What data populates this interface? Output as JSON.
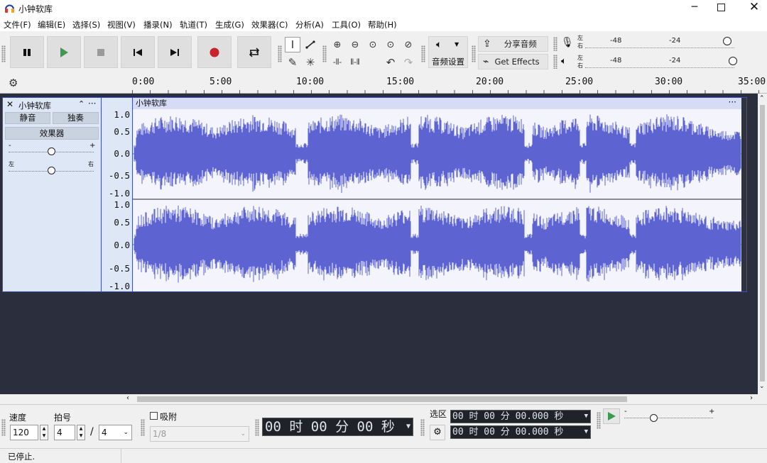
{
  "window": {
    "title": "小钟软库"
  },
  "menu": [
    "文件(F)",
    "编辑(E)",
    "选择(S)",
    "视图(V)",
    "播录(N)",
    "轨道(T)",
    "生成(G)",
    "效果器(C)",
    "分析(A)",
    "工具(O)",
    "帮助(H)"
  ],
  "toolbar": {
    "audio_setup_label": "音频设置",
    "share_audio_label": "分享音频",
    "get_effects_label": "Get Effects"
  },
  "meters": {
    "record": {
      "channels": [
        "左",
        "右"
      ],
      "marks": [
        "-48",
        "-24"
      ]
    },
    "playback": {
      "channels": [
        "左",
        "右"
      ],
      "marks": [
        "-48",
        "-24"
      ]
    }
  },
  "ruler": {
    "labels": [
      "0:00",
      "5:00",
      "10:00",
      "15:00",
      "20:00",
      "25:00",
      "30:00",
      "35:00"
    ]
  },
  "track": {
    "name": "小钟软库",
    "mute_label": "静音",
    "solo_label": "独奏",
    "effects_label": "效果器",
    "gain_minus": "-",
    "gain_plus": "+",
    "pan_left": "左",
    "pan_right": "右",
    "clip_name": "小钟软库",
    "scale_labels": [
      "1.0",
      "0.5",
      "0.0",
      "-0.5",
      "-1.0"
    ]
  },
  "bottom": {
    "tempo_label": "速度",
    "tempo_value": "120",
    "meter_label": "拍号",
    "meter_numerator": "4",
    "meter_separator": "/",
    "meter_denominator": "4",
    "snap_label": "吸附",
    "snap_value": "1/8",
    "time_display": "00 时 00 分 00 秒",
    "selection_label": "选区",
    "selection_start": "00 时 00 分 00.000 秒",
    "selection_end": "00 时 00 分 00.000 秒",
    "speed_minus": "-",
    "speed_plus": "+"
  },
  "status": {
    "text": "已停止."
  },
  "colors": {
    "waveform": "#5d63d0",
    "track_bg": "#2b2f3d",
    "record": "#c8222b",
    "play": "#3c9a4e"
  }
}
